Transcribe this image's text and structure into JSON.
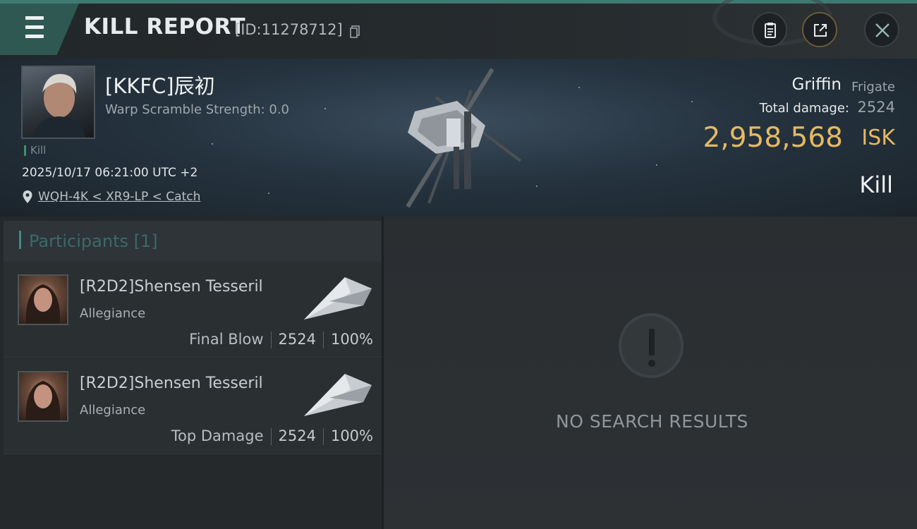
{
  "header": {
    "menu_icon": "hamburger-icon",
    "title": "KILL REPORT",
    "report_id": "[ID:11278712]",
    "copy_icon": "copy-icon",
    "actions": [
      {
        "name": "clipboard-button",
        "icon": "clipboard-icon"
      },
      {
        "name": "share-button",
        "icon": "share-icon"
      },
      {
        "name": "close-button",
        "icon": "close-icon"
      }
    ]
  },
  "victim": {
    "name": "[KKFC]辰初",
    "warp_scramble": "Warp Scramble Strength: 0.0",
    "tag": "Kill",
    "datetime": "2025/10/17 06:21:00 UTC +2",
    "location": "WQH-4K < XR9-LP < Catch",
    "ship_name": "Griffin",
    "ship_class": "Frigate",
    "total_damage_label": "Total damage:",
    "total_damage": "2524",
    "isk_value": "2,958,568",
    "isk_unit": "ISK",
    "type": "Kill"
  },
  "participants": {
    "title": "Participants [1]",
    "rows": [
      {
        "name": "[R2D2]Shensen Tesseril",
        "corp": "Allegiance",
        "label": "Final Blow",
        "damage": "2524",
        "percent": "100%"
      },
      {
        "name": "[R2D2]Shensen Tesseril",
        "corp": "Allegiance",
        "label": "Top Damage",
        "damage": "2524",
        "percent": "100%"
      }
    ]
  },
  "results": {
    "icon": "alert-icon",
    "empty_text": "NO SEARCH RESULTS"
  },
  "colors": {
    "accent": "#3e7a72",
    "isk": "#e5b964"
  }
}
